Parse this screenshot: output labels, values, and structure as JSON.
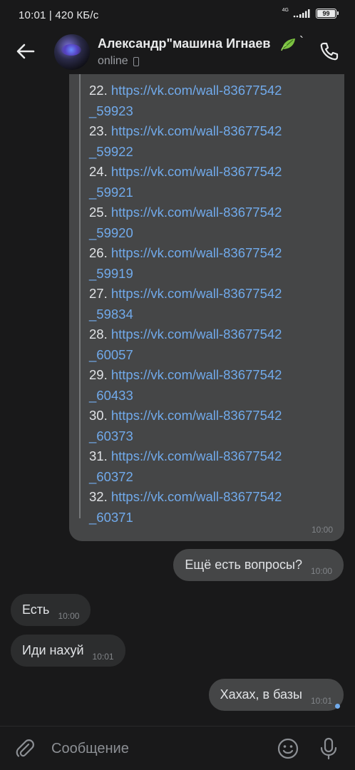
{
  "status_bar": {
    "time_speed": "10:01 | 420 КБ/с",
    "network": "4G",
    "battery": "99"
  },
  "header": {
    "name": "Александр\"машина Игнаев",
    "name_suffix": "`",
    "status": "online",
    "icons": {
      "back": "arrow-left-icon",
      "call": "phone-icon",
      "device": "mobile-device-icon",
      "emoji_leaf": "leaf-emoji-icon"
    }
  },
  "messages": {
    "links": [
      {
        "num": "22.",
        "url_line1": "https://vk.com/wall-83677542",
        "url_line2": "_59923"
      },
      {
        "num": "23.",
        "url_line1": "https://vk.com/wall-83677542",
        "url_line2": "_59922"
      },
      {
        "num": "24.",
        "url_line1": "https://vk.com/wall-83677542",
        "url_line2": "_59921"
      },
      {
        "num": "25.",
        "url_line1": "https://vk.com/wall-83677542",
        "url_line2": "_59920"
      },
      {
        "num": "26.",
        "url_line1": "https://vk.com/wall-83677542",
        "url_line2": "_59919"
      },
      {
        "num": "27.",
        "url_line1": "https://vk.com/wall-83677542",
        "url_line2": "_59834"
      },
      {
        "num": "28.",
        "url_line1": "https://vk.com/wall-83677542",
        "url_line2": "_60057"
      },
      {
        "num": "29.",
        "url_line1": "https://vk.com/wall-83677542",
        "url_line2": "_60433"
      },
      {
        "num": "30.",
        "url_line1": "https://vk.com/wall-83677542",
        "url_line2": "_60373"
      },
      {
        "num": "31.",
        "url_line1": "https://vk.com/wall-83677542",
        "url_line2": "_60372"
      },
      {
        "num": "32.",
        "url_line1": "https://vk.com/wall-83677542",
        "url_line2": "_60371"
      }
    ],
    "links_time": "10:00",
    "m1": {
      "text": "Ещё есть вопросы?",
      "time": "10:00"
    },
    "m2": {
      "text": "Есть",
      "time": "10:00"
    },
    "m3": {
      "text": "Иди нахуй",
      "time": "10:01"
    },
    "m4": {
      "text": "Хахах, в базы",
      "time": "10:01"
    }
  },
  "composer": {
    "placeholder": "Сообщение",
    "icons": {
      "attach": "paperclip-icon",
      "emoji": "smiley-icon",
      "mic": "microphone-icon"
    }
  },
  "colors": {
    "background": "#19191a",
    "bubble_out": "#454647",
    "bubble_in": "#2c2d2e",
    "link": "#71aaeb",
    "text": "#e1e3e6",
    "secondary": "#828589"
  }
}
